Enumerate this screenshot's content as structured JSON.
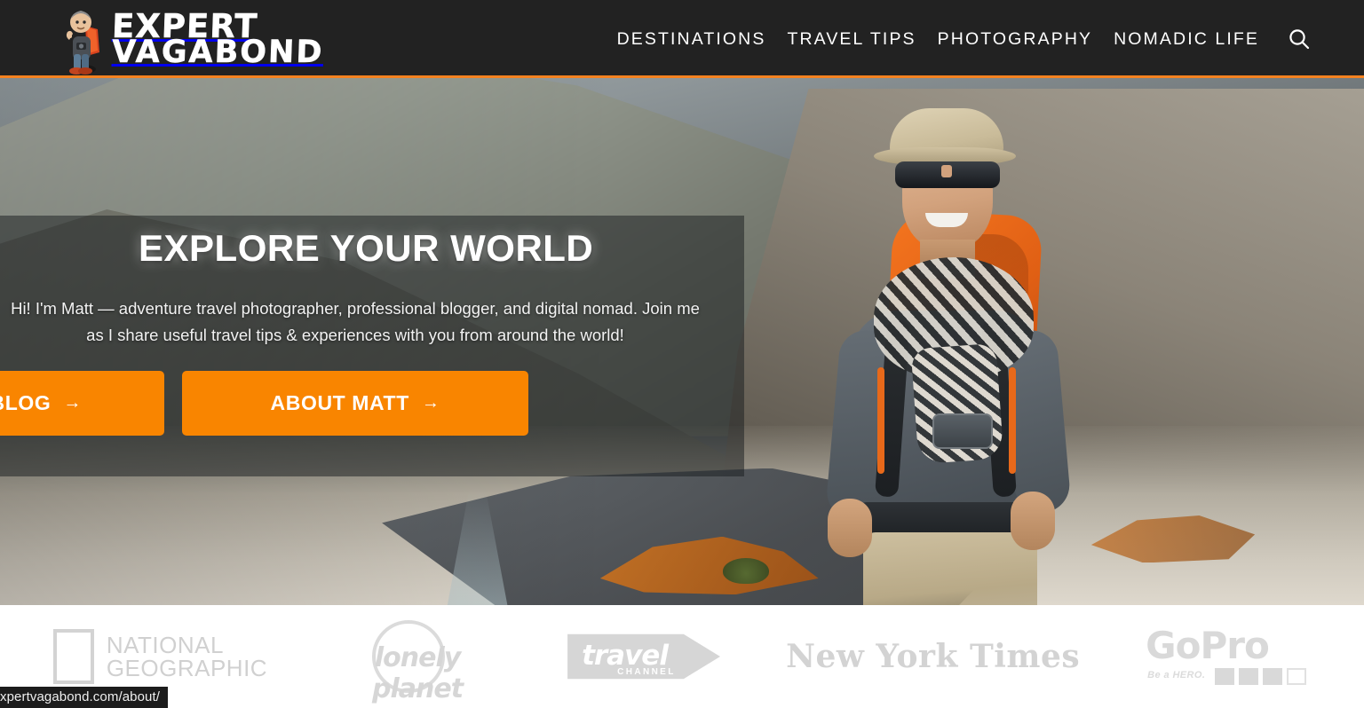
{
  "header": {
    "logo": {
      "line1": "EXPERT",
      "line2": "VAGABOND",
      "character_icon": "backpacker-character-icon"
    },
    "nav": [
      {
        "label": "DESTINATIONS"
      },
      {
        "label": "TRAVEL TIPS"
      },
      {
        "label": "PHOTOGRAPHY"
      },
      {
        "label": "NOMADIC LIFE"
      }
    ],
    "search_icon": "search-icon",
    "background_color": "#222222",
    "accent_color": "#f58220"
  },
  "hero": {
    "title": "EXPLORE YOUR WORLD",
    "subtitle": "Hi! I'm Matt — adventure travel photographer, professional blogger, and digital nomad. Join me as I share useful travel tips & experiences with you from around the world!",
    "buttons": [
      {
        "label": "TRAVEL BLOG",
        "arrow": "→"
      },
      {
        "label": "ABOUT MATT",
        "arrow": "→"
      }
    ],
    "button_color": "#f98500",
    "overlay_color": "rgba(26,30,33,.52)"
  },
  "press_logos": [
    {
      "name": "National Geographic",
      "line1": "NATIONAL",
      "line2": "GEOGRAPHIC"
    },
    {
      "name": "Lonely Planet",
      "text": "lonely planet"
    },
    {
      "name": "Travel Channel",
      "main": "travel",
      "sub": "CHANNEL"
    },
    {
      "name": "The New York Times",
      "text": "New York Times"
    },
    {
      "name": "GoPro",
      "text": "GoPro",
      "tagline": "Be a HERO."
    }
  ],
  "statusbar": {
    "url": "xpertvagabond.com/about/"
  }
}
